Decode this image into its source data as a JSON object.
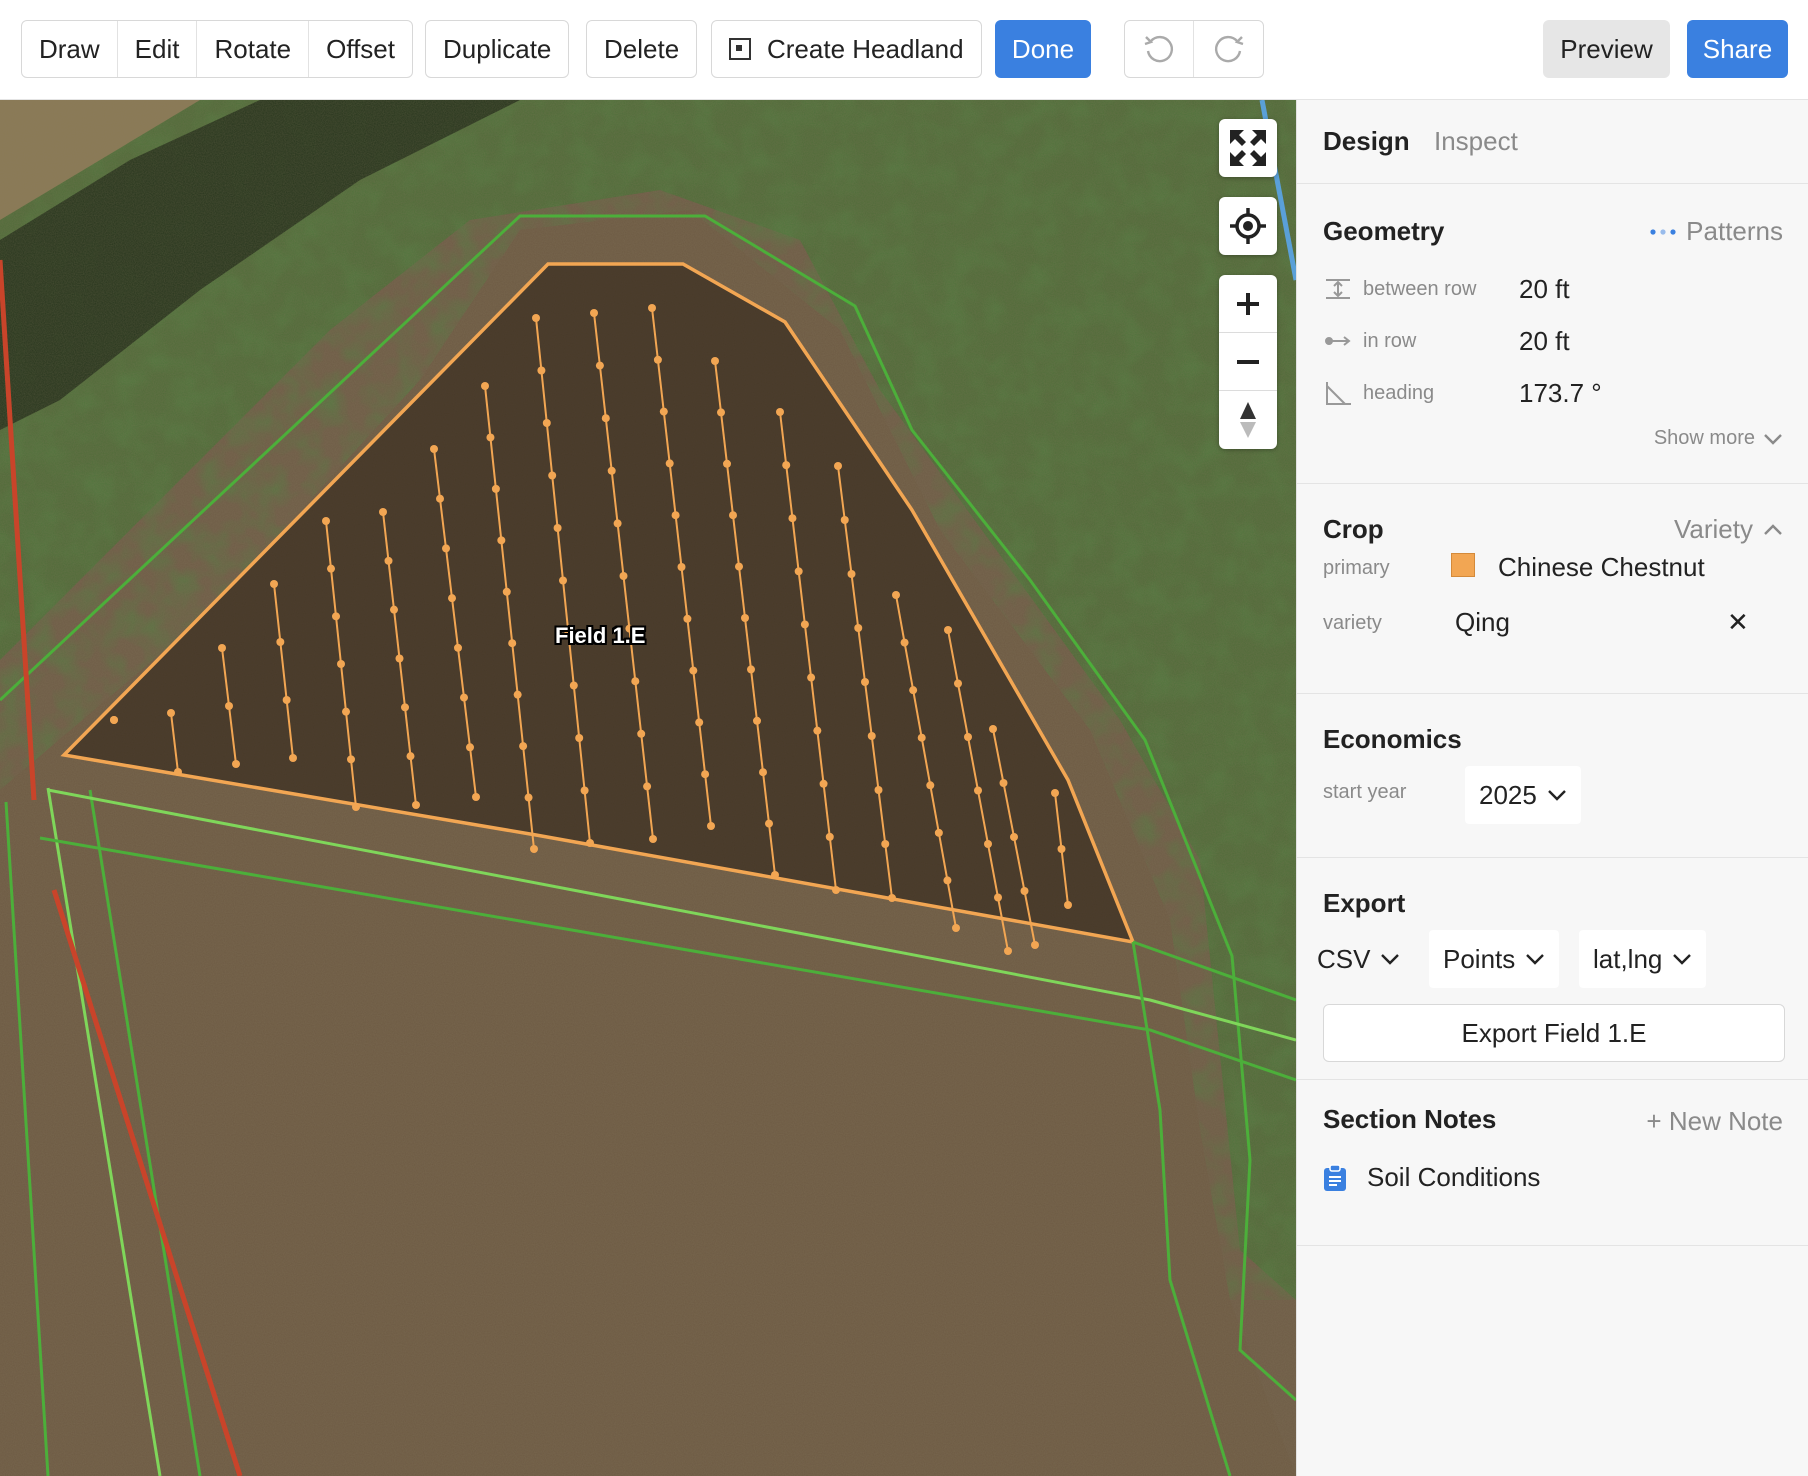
{
  "toolbar": {
    "edit_tools": [
      "Draw",
      "Edit",
      "Rotate",
      "Offset"
    ],
    "duplicate_label": "Duplicate",
    "delete_label": "Delete",
    "create_headland_label": "Create Headland",
    "done_label": "Done",
    "preview_label": "Preview",
    "share_label": "Share",
    "icons": [
      "undo-icon",
      "redo-icon",
      "headland-icon"
    ]
  },
  "map": {
    "field_label": "Field 1.E",
    "controls": [
      "fullscreen-icon",
      "locate-icon",
      "zoom-in-icon",
      "zoom-out-icon",
      "compass-icon"
    ],
    "colors": {
      "planting_rows": "#f2a653",
      "field_boundary": "#f2a653",
      "parcel_lines": "#4caf3a",
      "road_line": "#c9442a",
      "water_line": "#5aa0d8"
    }
  },
  "sidebar": {
    "tabs": {
      "design": "Design",
      "inspect": "Inspect"
    },
    "geometry": {
      "title": "Geometry",
      "patterns_label": "Patterns",
      "rows": [
        {
          "label": "between row",
          "value": "20 ft",
          "icon": "between-row-icon"
        },
        {
          "label": "in row",
          "value": "20 ft",
          "icon": "in-row-icon"
        },
        {
          "label": "heading",
          "value": "173.7 °",
          "icon": "heading-icon"
        }
      ],
      "show_more_label": "Show more"
    },
    "crop": {
      "title": "Crop",
      "variety_toggle_label": "Variety",
      "primary_label": "primary",
      "primary_value": "Chinese Chestnut",
      "primary_color": "#f2a653",
      "variety_label": "variety",
      "variety_value": "Qing"
    },
    "economics": {
      "title": "Economics",
      "start_year_label": "start year",
      "start_year_value": "2025"
    },
    "export": {
      "title": "Export",
      "format": "CSV",
      "geometry": "Points",
      "coords": "lat,lng",
      "export_button_label": "Export Field 1.E"
    },
    "notes": {
      "title": "Section Notes",
      "new_note_label": "+ New Note",
      "items": [
        "Soil Conditions"
      ]
    }
  },
  "accent_color": "#3a80e0"
}
